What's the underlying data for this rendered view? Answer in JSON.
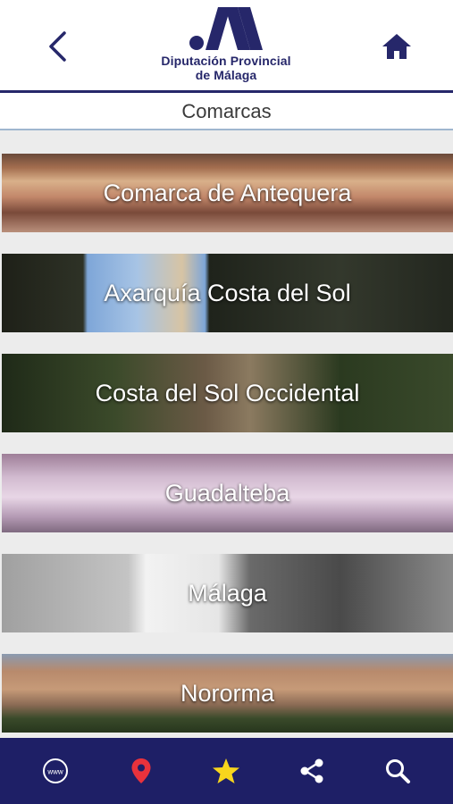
{
  "header": {
    "logo_line1": "Diputación Provincial",
    "logo_line2": "de Málaga",
    "brand_color": "#26276a"
  },
  "subheader": {
    "title": "Comarcas"
  },
  "comarcas": [
    {
      "label": "Comarca de Antequera"
    },
    {
      "label": "Axarquía Costa del Sol"
    },
    {
      "label": "Costa del Sol Occidental"
    },
    {
      "label": "Guadalteba"
    },
    {
      "label": "Málaga"
    },
    {
      "label": "Nororma"
    }
  ],
  "tabbar": {
    "background": "#1e1f66",
    "items": [
      {
        "icon": "www-globe-icon"
      },
      {
        "icon": "map-pin-icon",
        "color": "#e8323c"
      },
      {
        "icon": "star-icon",
        "color": "#f7d51d"
      },
      {
        "icon": "share-icon"
      },
      {
        "icon": "search-icon"
      }
    ]
  }
}
